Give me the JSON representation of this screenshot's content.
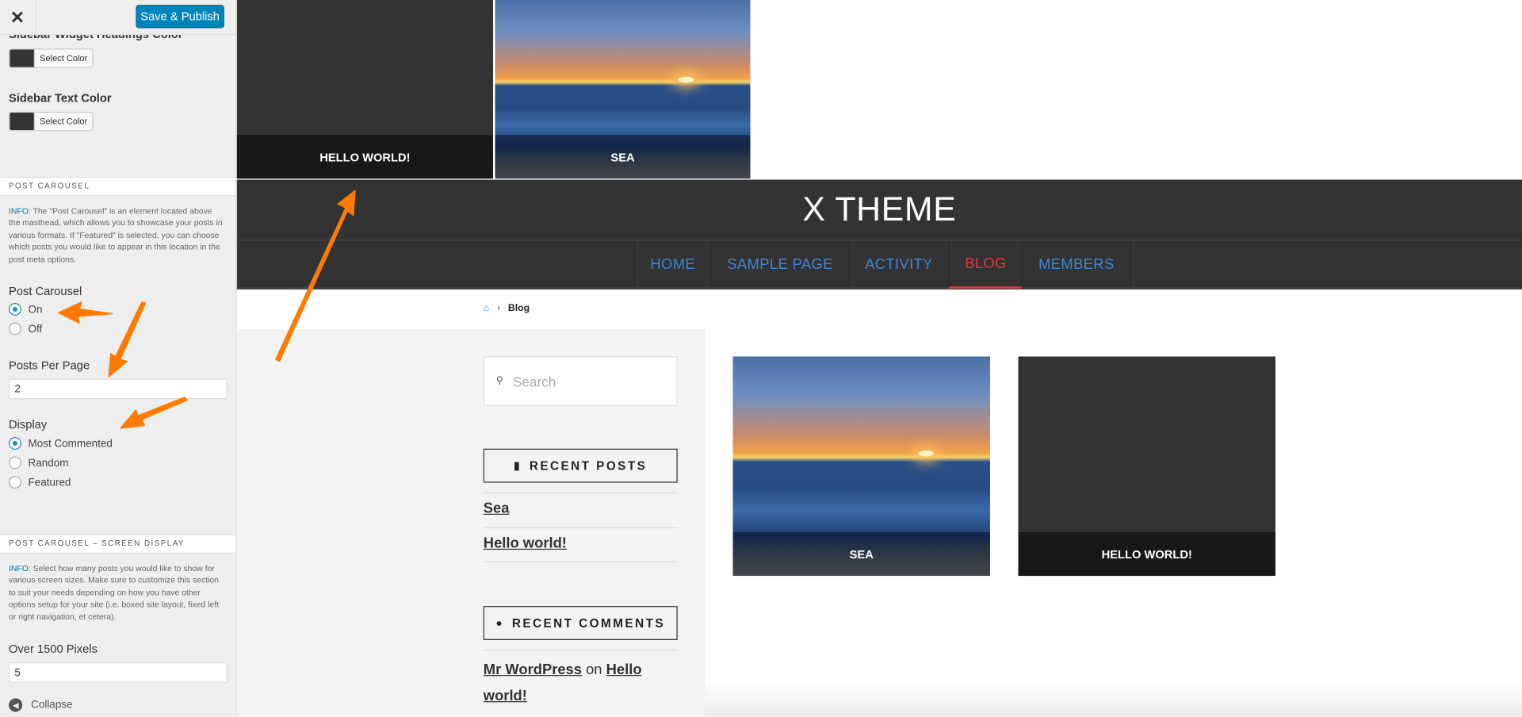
{
  "customizer": {
    "close_label": "✕",
    "publish_label": "Save & Publish",
    "sidebar_widget_heading_label": "Sidebar Widget Headings Color",
    "select_color_label": "Select Color",
    "sidebar_text_color_label": "Sidebar Text Color",
    "post_carousel_section": "POST CAROUSEL",
    "post_carousel_info_tag": "INFO:",
    "post_carousel_info": " The \"Post Carousel\" is an element located above the masthead, which allows you to showcase your posts in various formats. If \"Featured\" is selected, you can choose which posts you would like to appear in this location in the post meta options.",
    "post_carousel_label": "Post Carousel",
    "post_carousel_options": [
      "On",
      "Off"
    ],
    "post_carousel_selected": "On",
    "posts_per_page_label": "Posts Per Page",
    "posts_per_page_value": "2",
    "display_label": "Display",
    "display_options": [
      "Most Commented",
      "Random",
      "Featured"
    ],
    "display_selected": "Most Commented",
    "screen_display_section": "POST CAROUSEL – SCREEN DISPLAY",
    "screen_info_tag": "INFO:",
    "screen_info": " Select how many posts you would like to show for various screen sizes. Make sure to customize this section to suit your needs depending on how you have other options setup for your site (i.e. boxed site layout, fixed left or right navigation, et cetera).",
    "over_1500_label": "Over 1500 Pixels",
    "over_1500_value": "5",
    "collapse_label": "Collapse"
  },
  "preview": {
    "carousel": [
      "HELLO WORLD!",
      "SEA"
    ],
    "site_title": "X THEME",
    "nav": [
      "HOME",
      "SAMPLE PAGE",
      "ACTIVITY",
      "BLOG",
      "MEMBERS"
    ],
    "nav_active": "BLOG",
    "breadcrumb_current": "Blog",
    "search_placeholder": "Search",
    "recent_posts_title": "RECENT POSTS",
    "recent_posts": [
      "Sea",
      "Hello world!"
    ],
    "recent_comments_title": "RECENT COMMENTS",
    "comment_author": "Mr WordPress",
    "comment_on": " on ",
    "comment_post": "Hello world!",
    "posts": [
      "SEA",
      "HELLO WORLD!"
    ]
  },
  "colors": {
    "publish_button": "#0085ba",
    "masthead": "#333333",
    "nav_link": "#3f86d4",
    "nav_active": "#e13a3a",
    "annotation_arrow": "#ff7a00"
  }
}
